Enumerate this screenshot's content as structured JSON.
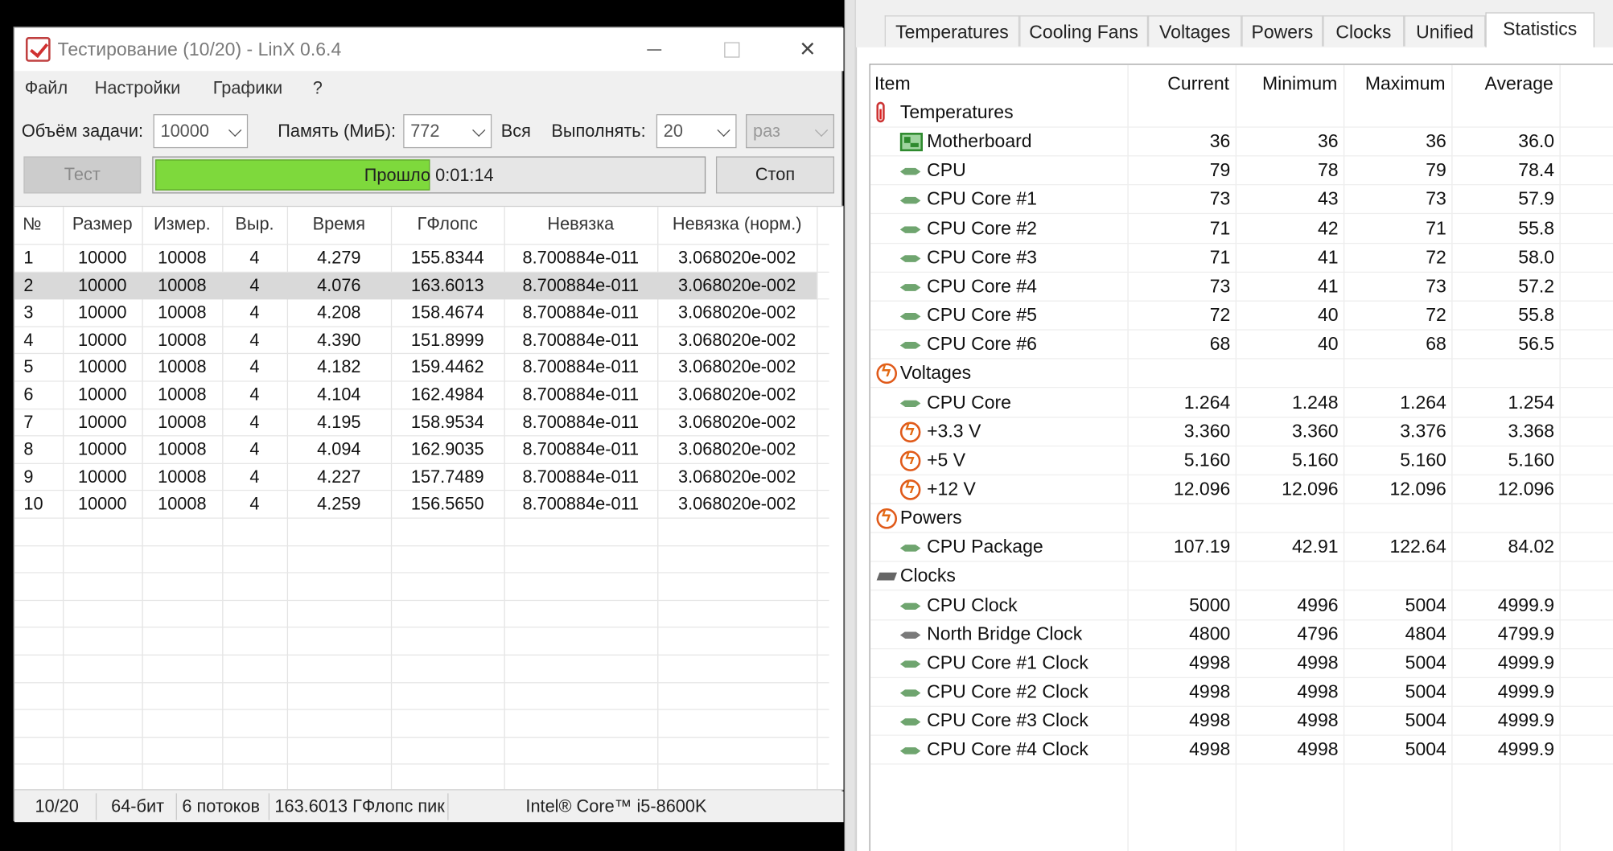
{
  "linx": {
    "title": "Тестирование (10/20) - LinX 0.6.4",
    "menu": [
      "Файл",
      "Настройки",
      "Графики",
      "?"
    ],
    "params": {
      "task_size_label": "Объём задачи:",
      "task_size_value": "10000",
      "memory_label": "Память (МиБ):",
      "memory_value": "772",
      "all_label": "Вся",
      "run_label": "Выполнять:",
      "run_value": "20",
      "run_unit": "раз"
    },
    "test_button": "Тест",
    "stop_button": "Стоп",
    "progress": {
      "fraction": 0.5,
      "label": "Прошло 0:01:14"
    },
    "columns": [
      "№",
      "Размер",
      "Измер.",
      "Выр.",
      "Время",
      "ГФлопс",
      "Невязка",
      "Невязка (норм.)"
    ],
    "selected_row": 1,
    "rows": [
      [
        "1",
        "10000",
        "10008",
        "4",
        "4.279",
        "155.8344",
        "8.700884e-011",
        "3.068020e-002"
      ],
      [
        "2",
        "10000",
        "10008",
        "4",
        "4.076",
        "163.6013",
        "8.700884e-011",
        "3.068020e-002"
      ],
      [
        "3",
        "10000",
        "10008",
        "4",
        "4.208",
        "158.4674",
        "8.700884e-011",
        "3.068020e-002"
      ],
      [
        "4",
        "10000",
        "10008",
        "4",
        "4.390",
        "151.8999",
        "8.700884e-011",
        "3.068020e-002"
      ],
      [
        "5",
        "10000",
        "10008",
        "4",
        "4.182",
        "159.4462",
        "8.700884e-011",
        "3.068020e-002"
      ],
      [
        "6",
        "10000",
        "10008",
        "4",
        "4.104",
        "162.4984",
        "8.700884e-011",
        "3.068020e-002"
      ],
      [
        "7",
        "10000",
        "10008",
        "4",
        "4.195",
        "158.9534",
        "8.700884e-011",
        "3.068020e-002"
      ],
      [
        "8",
        "10000",
        "10008",
        "4",
        "4.094",
        "162.9035",
        "8.700884e-011",
        "3.068020e-002"
      ],
      [
        "9",
        "10000",
        "10008",
        "4",
        "4.227",
        "157.7489",
        "8.700884e-011",
        "3.068020e-002"
      ],
      [
        "10",
        "10000",
        "10008",
        "4",
        "4.259",
        "156.5650",
        "8.700884e-011",
        "3.068020e-002"
      ]
    ],
    "status": {
      "progress": "10/20",
      "bits": "64-бит",
      "threads": "6 потоков",
      "peak": "163.6013 ГФлопс пик",
      "cpu": "Intel® Core™ i5-8600K"
    }
  },
  "hwmonitor": {
    "tabs": [
      "Temperatures",
      "Cooling Fans",
      "Voltages",
      "Powers",
      "Clocks",
      "Unified",
      "Statistics"
    ],
    "active_tab": "Statistics",
    "columns": [
      "Item",
      "Current",
      "Minimum",
      "Maximum",
      "Average"
    ],
    "rows": [
      {
        "kind": "group",
        "icon": "thermometer-icon",
        "name": "Temperatures"
      },
      {
        "kind": "item",
        "icon": "motherboard-icon",
        "name": "Motherboard",
        "values": [
          "36",
          "36",
          "36",
          "36.0"
        ]
      },
      {
        "kind": "item",
        "icon": "chip-icon",
        "name": "CPU",
        "values": [
          "79",
          "78",
          "79",
          "78.4"
        ]
      },
      {
        "kind": "item",
        "icon": "chip-icon",
        "name": "CPU Core #1",
        "values": [
          "73",
          "43",
          "73",
          "57.9"
        ]
      },
      {
        "kind": "item",
        "icon": "chip-icon",
        "name": "CPU Core #2",
        "values": [
          "71",
          "42",
          "71",
          "55.8"
        ]
      },
      {
        "kind": "item",
        "icon": "chip-icon",
        "name": "CPU Core #3",
        "values": [
          "71",
          "41",
          "72",
          "58.0"
        ]
      },
      {
        "kind": "item",
        "icon": "chip-icon",
        "name": "CPU Core #4",
        "values": [
          "73",
          "41",
          "73",
          "57.2"
        ]
      },
      {
        "kind": "item",
        "icon": "chip-icon",
        "name": "CPU Core #5",
        "values": [
          "72",
          "40",
          "72",
          "55.8"
        ]
      },
      {
        "kind": "item",
        "icon": "chip-icon",
        "name": "CPU Core #6",
        "values": [
          "68",
          "40",
          "68",
          "56.5"
        ]
      },
      {
        "kind": "group",
        "icon": "lightning-icon",
        "name": "Voltages"
      },
      {
        "kind": "item",
        "icon": "chip-icon",
        "name": "CPU Core",
        "values": [
          "1.264",
          "1.248",
          "1.264",
          "1.254"
        ]
      },
      {
        "kind": "item",
        "icon": "lightning-icon",
        "name": "+3.3 V",
        "values": [
          "3.360",
          "3.360",
          "3.376",
          "3.368"
        ]
      },
      {
        "kind": "item",
        "icon": "lightning-icon",
        "name": "+5 V",
        "values": [
          "5.160",
          "5.160",
          "5.160",
          "5.160"
        ]
      },
      {
        "kind": "item",
        "icon": "lightning-icon",
        "name": "+12 V",
        "values": [
          "12.096",
          "12.096",
          "12.096",
          "12.096"
        ]
      },
      {
        "kind": "group",
        "icon": "lightning-icon",
        "name": "Powers"
      },
      {
        "kind": "item",
        "icon": "chip-icon",
        "name": "CPU Package",
        "values": [
          "107.19",
          "42.91",
          "122.64",
          "84.02"
        ]
      },
      {
        "kind": "group",
        "icon": "clock-chip-icon",
        "name": "Clocks"
      },
      {
        "kind": "item",
        "icon": "chip-icon",
        "name": "CPU Clock",
        "values": [
          "5000",
          "4996",
          "5004",
          "4999.9"
        ]
      },
      {
        "kind": "item",
        "icon": "northbridge-icon",
        "name": "North Bridge Clock",
        "values": [
          "4800",
          "4796",
          "4804",
          "4799.9"
        ]
      },
      {
        "kind": "item",
        "icon": "chip-icon",
        "name": "CPU Core #1 Clock",
        "values": [
          "4998",
          "4998",
          "5004",
          "4999.9"
        ]
      },
      {
        "kind": "item",
        "icon": "chip-icon",
        "name": "CPU Core #2 Clock",
        "values": [
          "4998",
          "4998",
          "5004",
          "4999.9"
        ]
      },
      {
        "kind": "item",
        "icon": "chip-icon",
        "name": "CPU Core #3 Clock",
        "values": [
          "4998",
          "4998",
          "5004",
          "4999.9"
        ]
      },
      {
        "kind": "item",
        "icon": "chip-icon",
        "name": "CPU Core #4 Clock",
        "values": [
          "4998",
          "4998",
          "5004",
          "4999.9"
        ]
      }
    ]
  },
  "colors": {
    "progress_fill": "#7ed93c",
    "selected_row": "#d9d9d9",
    "voltage_icon": "#e36a14",
    "chip_icon": "#6fa56f"
  }
}
